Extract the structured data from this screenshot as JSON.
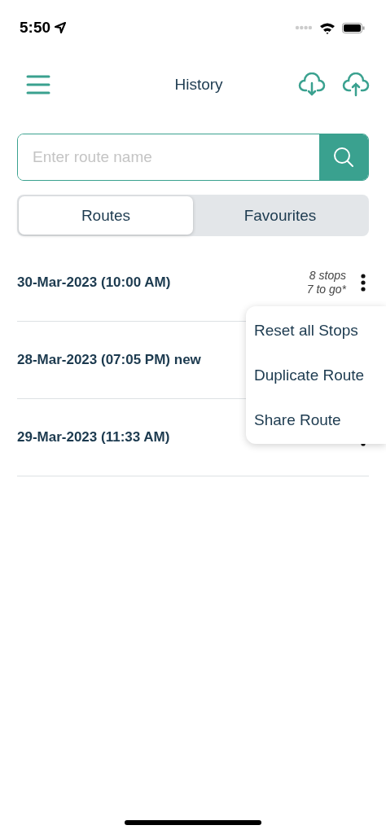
{
  "status_bar": {
    "time": "5:50"
  },
  "header": {
    "title": "History"
  },
  "search": {
    "placeholder": "Enter route name"
  },
  "tabs": [
    {
      "label": "Routes",
      "selected": true
    },
    {
      "label": "Favourites",
      "selected": false
    }
  ],
  "routes": [
    {
      "title": "30-Mar-2023 (10:00 AM)",
      "stops": "8 stops",
      "to_go": "7 to go*",
      "menu_button": true
    },
    {
      "title": "28-Mar-2023 (07:05 PM) new",
      "menu_button": false
    },
    {
      "title": "29-Mar-2023 (11:33 AM)",
      "menu_button": true
    }
  ],
  "context_menu": {
    "items": [
      "Reset all Stops",
      "Duplicate Route",
      "Share Route"
    ]
  }
}
